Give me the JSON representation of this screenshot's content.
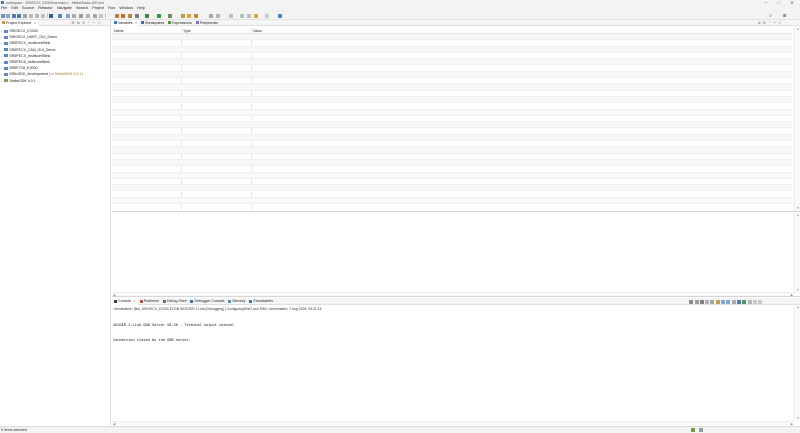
{
  "window": {
    "title": "workspace - SRIGECX_E2000/src/main.c - StellarStudio-IDE.exe",
    "minimize": "─",
    "maximize": "□",
    "close": "✕"
  },
  "menu": [
    "File",
    "Edit",
    "Source",
    "Refactor",
    "Navigate",
    "Search",
    "Project",
    "Run",
    "Window",
    "Help"
  ],
  "toolbar_right": {
    "search_icon": "⌕",
    "perspective_icon": "⊞"
  },
  "project_explorer": {
    "tab_label": "Project Explorer",
    "close": "✕",
    "tools": [
      "⊟",
      "⇆",
      "⚲",
      "⋮",
      "─",
      "□"
    ],
    "items": [
      {
        "label": "SRIGECX_E2000",
        "decor": ""
      },
      {
        "label": "SRIGECX_UART_GUI_Demo",
        "decor": ""
      },
      {
        "label": "SR5PECX_multicoreBlink",
        "decor": ""
      },
      {
        "label": "SR5PECX_CAN_GUI_Demo",
        "decor": ""
      },
      {
        "label": "SR5PECX_multicoreBlink",
        "decor": ""
      },
      {
        "label": "SR5PEC8_multicoreBlink",
        "decor": ""
      },
      {
        "label": "SR6P7C8_E2000",
        "decor": ""
      },
      {
        "label": "SR6xSDK_development",
        "decor": "[ in StellarSDK 4.0.1 ]"
      },
      {
        "label": "StellarSDK 4.0.1",
        "decor": ""
      }
    ]
  },
  "variables_panel": {
    "tabs": [
      {
        "label": "Variables",
        "active": true
      },
      {
        "label": "Breakpoints",
        "active": false
      },
      {
        "label": "Expressions",
        "active": false
      },
      {
        "label": "Peripherals",
        "active": false
      }
    ],
    "columns": [
      "Name",
      "Type",
      "Value"
    ],
    "tools": [
      "⇲",
      "⊟",
      "⋮",
      "─",
      "□"
    ]
  },
  "console_panel": {
    "tabs": [
      {
        "label": "Console",
        "active": true
      },
      {
        "label": "Problems",
        "active": false
      },
      {
        "label": "Debug Shell",
        "active": false
      },
      {
        "label": "Debugger Console",
        "active": false
      },
      {
        "label": "Memory",
        "active": false
      },
      {
        "label": "Executables",
        "active": false
      }
    ],
    "terminated_line": "<terminated> [link_SRIGECX_E2000 ECDB SEGGER J-Link [Debugging] ] ConfiguringSWO and SWV <terminated> 7 Aug 2026, 09:21:16",
    "output": [
      "SEGGER J-Link GDB Server V8.56 - Terminal output channel",
      "Connection closed by the GDB server."
    ]
  },
  "statusbar": {
    "text": "0 items selected"
  },
  "colors": {
    "accent": "#4a7ab8",
    "folder": "#5b88c4",
    "chrome": "#f3f3f3"
  }
}
